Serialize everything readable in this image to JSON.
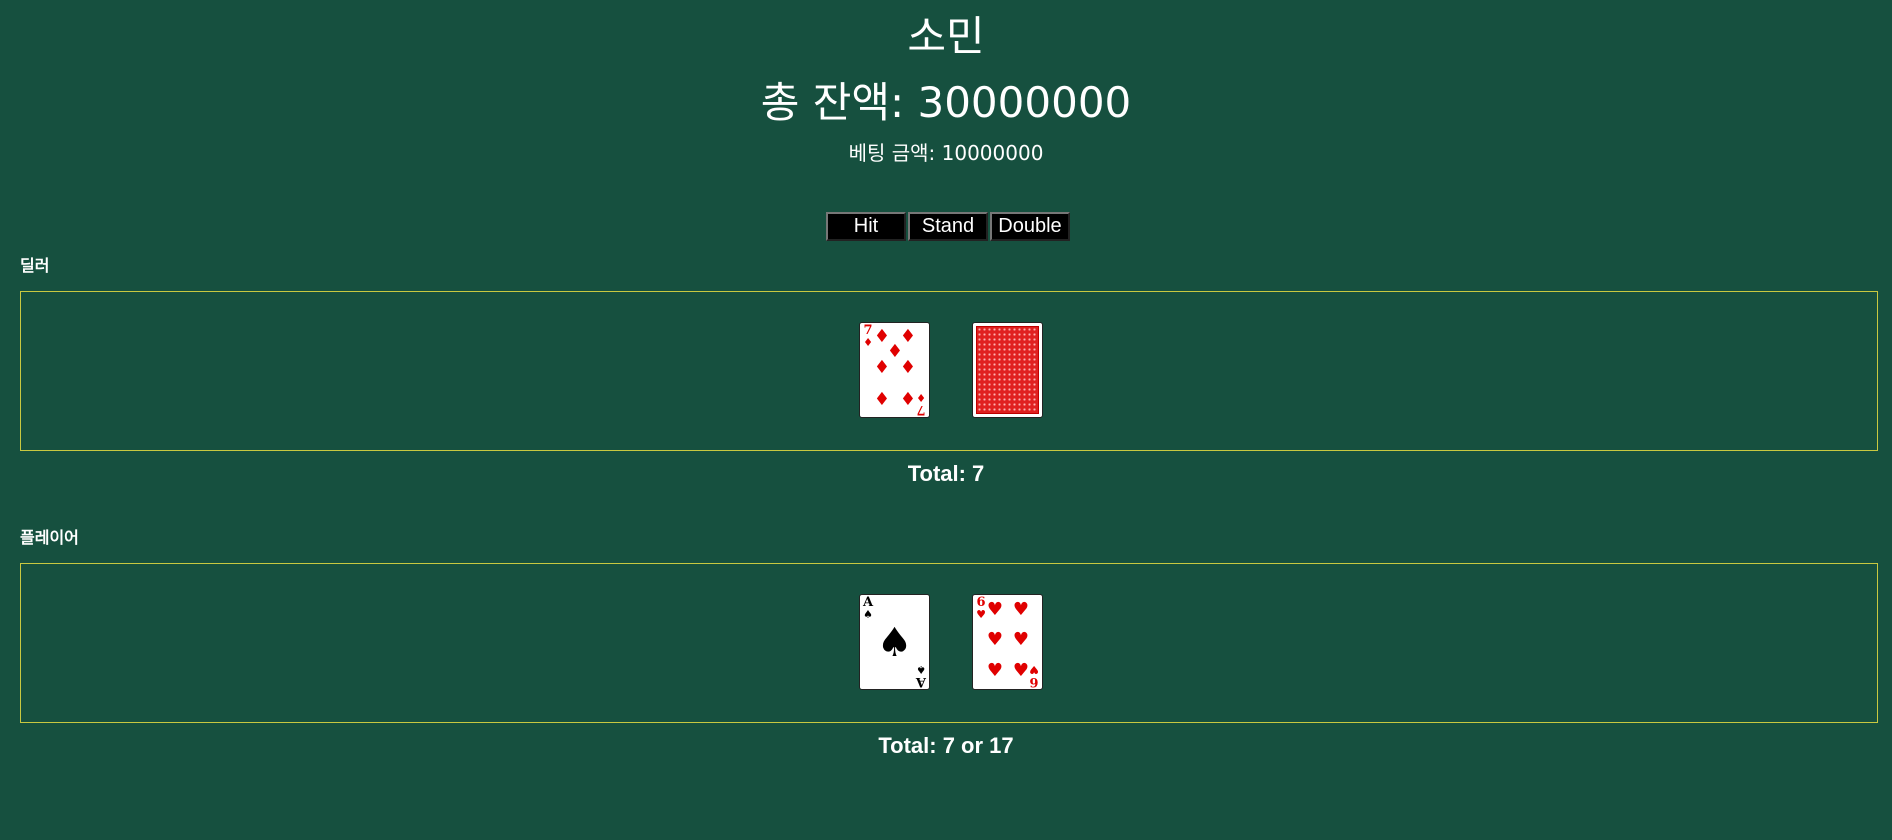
{
  "header": {
    "player_name": "소민",
    "balance_text": "총 잔액: 30000000",
    "bet_text": "베팅 금액: 10000000"
  },
  "controls": {
    "hit_label": "Hit",
    "stand_label": "Stand",
    "double_label": "Double"
  },
  "dealer": {
    "label": "딜러",
    "total_text": "Total: 7",
    "cards": [
      {
        "rank": "7",
        "suit": "♦",
        "color": "red",
        "face_up": true
      },
      {
        "rank": "",
        "suit": "",
        "color": "red",
        "face_up": false
      }
    ]
  },
  "player": {
    "label": "플레이어",
    "total_text": "Total: 7 or 17",
    "cards": [
      {
        "rank": "A",
        "suit": "♠",
        "color": "black",
        "face_up": true
      },
      {
        "rank": "6",
        "suit": "♥",
        "color": "red",
        "face_up": true
      }
    ]
  },
  "colors": {
    "table_felt": "#16503f",
    "area_border": "#c8c840",
    "red_suit": "#e00000",
    "button_bg": "#000000"
  }
}
